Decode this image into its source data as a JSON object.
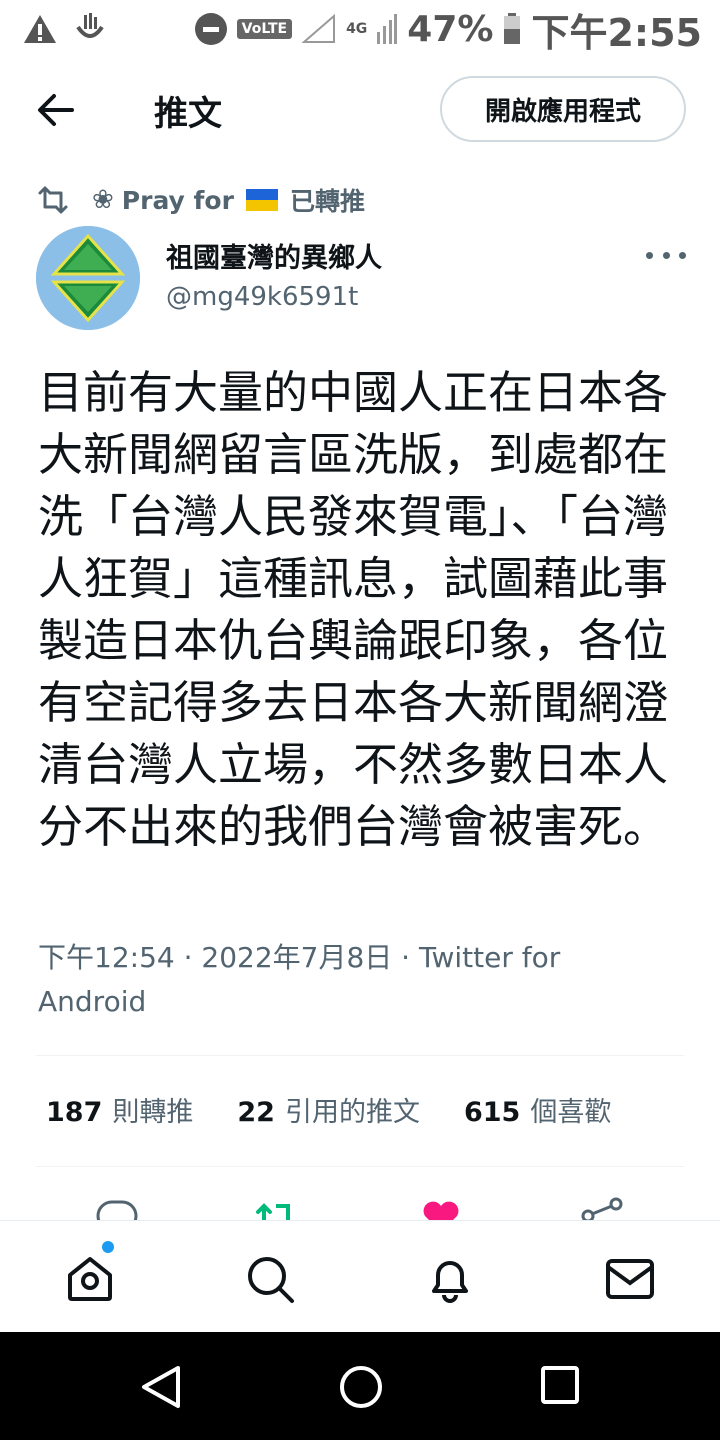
{
  "status_bar": {
    "network": "VoLTE",
    "signal": "4G",
    "battery": "47%",
    "time": "下午2:55"
  },
  "header": {
    "title": "推文",
    "open_app": "開啟應用程式"
  },
  "retweet": {
    "name_prefix": "Pray for",
    "label": "已轉推"
  },
  "author": {
    "name": "祖國臺灣的異鄉人",
    "handle": "@mg49k6591t"
  },
  "tweet": {
    "text": "目前有大量的中國人正在日本各大新聞網留言區洗版，到處都在洗「台灣人民發來賀電」、「台灣人狂賀」這種訊息，試圖藉此事製造日本仇台輿論跟印象，各位有空記得多去日本各大新聞網澄清台灣人立場，不然多數日本人分不出來的我們台灣會被害死。",
    "meta_line1": "下午12:54 · 2022年7月8日 · Twitter for",
    "meta_line2": "Android"
  },
  "stats": {
    "retweets": "187",
    "retweets_label": "則轉推",
    "quotes": "22",
    "quotes_label": "引用的推文",
    "likes": "615",
    "likes_label": "個喜歡"
  },
  "colors": {
    "accent": "#1d9bf0",
    "retweet": "#00ba7c",
    "like": "#f91880",
    "secondary_text": "#536471"
  },
  "bottom_nav": [
    "home-icon",
    "search-icon",
    "notifications-icon",
    "messages-icon"
  ],
  "system_nav": [
    "back-triangle",
    "home-circle",
    "recents-square"
  ]
}
